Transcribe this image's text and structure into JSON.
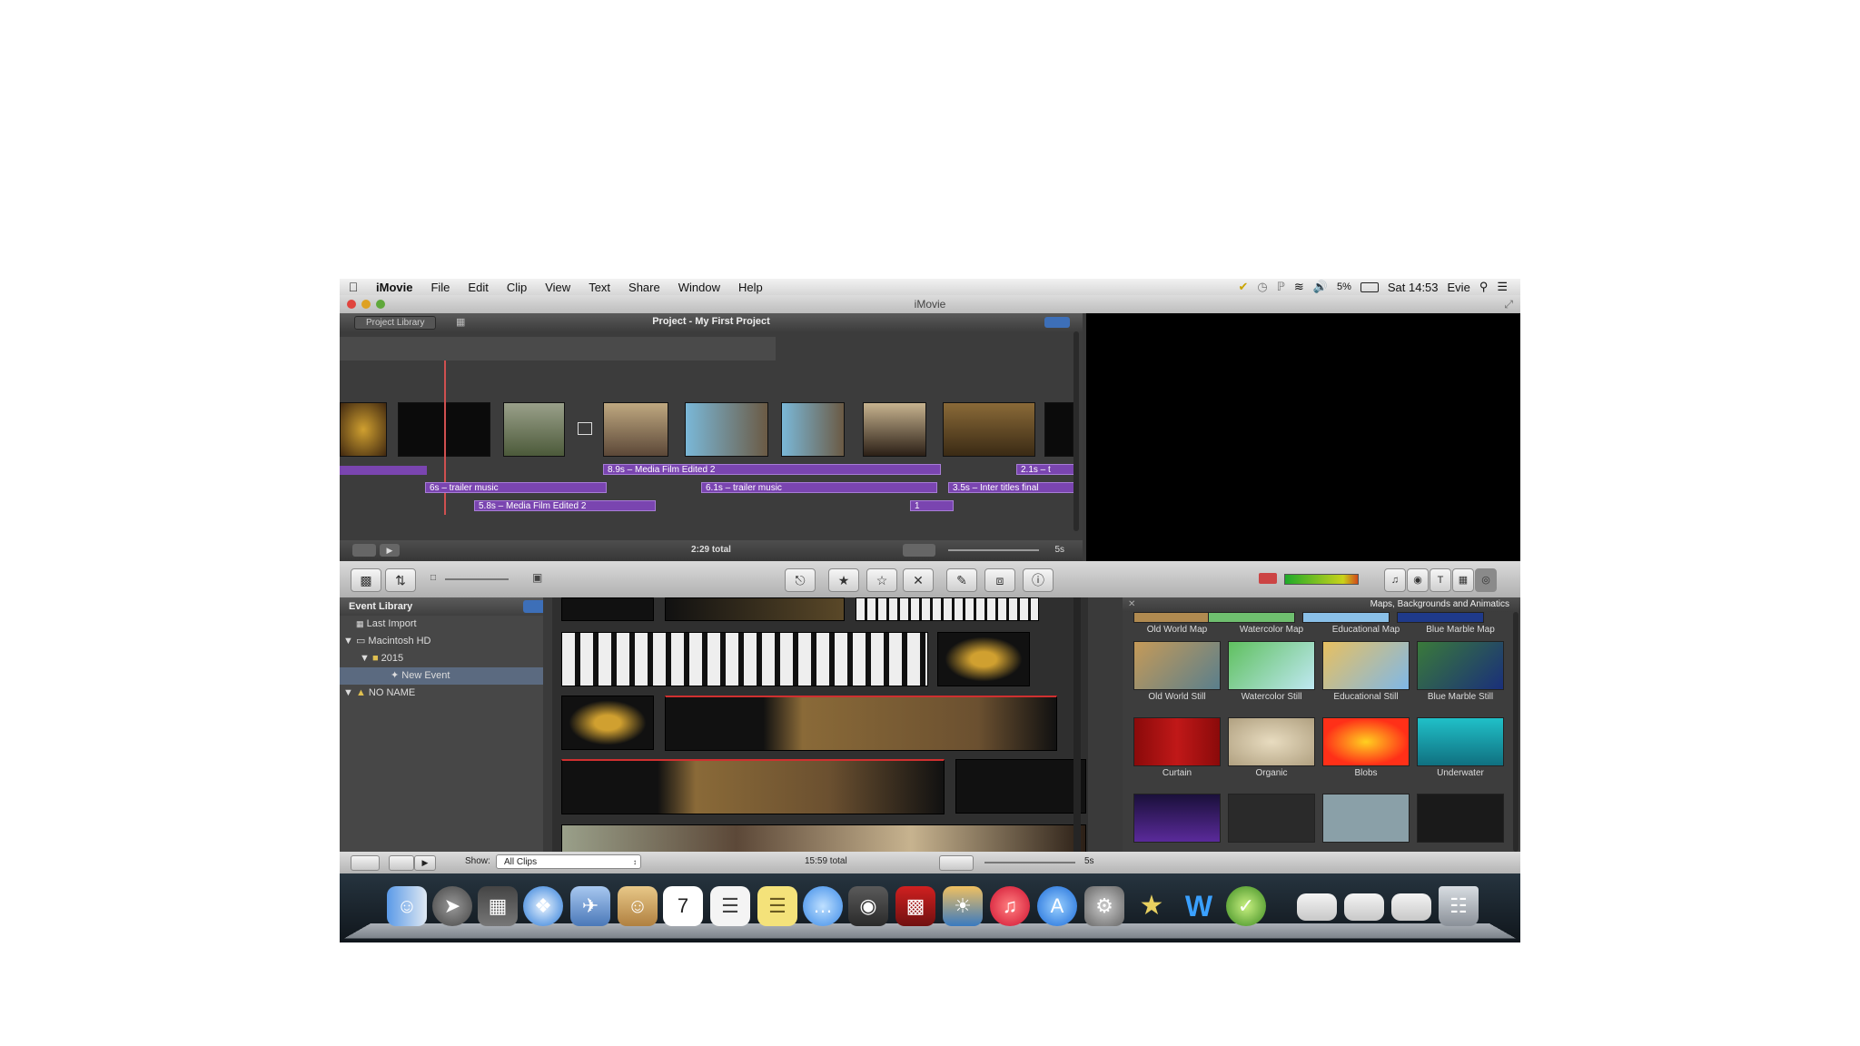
{
  "menubar": {
    "app": "iMovie",
    "items": [
      "File",
      "Edit",
      "Clip",
      "View",
      "Text",
      "Share",
      "Window",
      "Help"
    ],
    "battery": "5%",
    "clock": "Sat 14:53",
    "user": "Evie"
  },
  "window": {
    "title": "iMovie"
  },
  "project": {
    "library_button": "Project Library",
    "title": "Project - My First Project",
    "total": "2:29 total",
    "zoom": "5s",
    "tracks": [
      "8.9s – Media Film Edited 2",
      "2.1s – t",
      "6s – trailer music",
      "6.1s – trailer music",
      "3.5s – Inter titles final",
      "5.8s – Media Film Edited 2",
      "1"
    ]
  },
  "event_library": {
    "title": "Event Library",
    "items": [
      "Last Import",
      "Macintosh HD",
      "2015",
      "New Event",
      "NO NAME"
    ]
  },
  "maps_panel": {
    "title": "Maps, Backgrounds and Animatics",
    "row1": [
      "Old World Map",
      "Watercolor Map",
      "Educational Map",
      "Blue Marble Map"
    ],
    "row2": [
      "Old World Still",
      "Watercolor Still",
      "Educational Still",
      "Blue Marble Still"
    ],
    "row3": [
      "Curtain",
      "Organic",
      "Blobs",
      "Underwater"
    ]
  },
  "bottom": {
    "show_label": "Show:",
    "show_value": "All Clips",
    "total": "15:59 total",
    "zoom": "5s"
  },
  "colors": {
    "track": "#7a45b0",
    "selection": "#5b6a80"
  }
}
